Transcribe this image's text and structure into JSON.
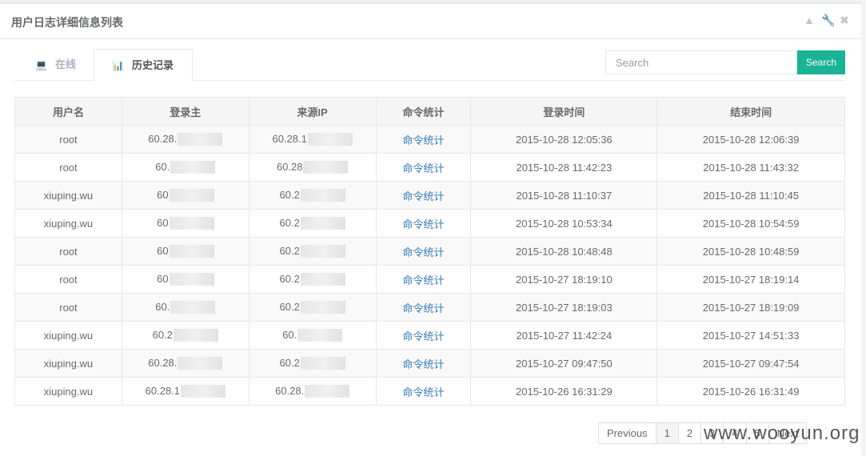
{
  "panel": {
    "title": "用户日志详细信息列表"
  },
  "tools": {
    "collapse": "▲",
    "settings": "🔧",
    "close": "✖"
  },
  "tabs": [
    {
      "label": "在线",
      "icon": "laptop-icon"
    },
    {
      "label": "历史记录",
      "icon": "bar-chart-icon"
    }
  ],
  "search": {
    "placeholder": "Search",
    "button": "Search"
  },
  "table": {
    "headers": [
      "用户名",
      "登录主",
      "来源IP",
      "命令统计",
      "登录时间",
      "结束时间"
    ],
    "rows": [
      {
        "user": "root",
        "host": "60.28.",
        "ip": "60.28.1",
        "cmd": "命令统计",
        "start": "2015-10-28 12:05:36",
        "end": "2015-10-28 12:06:39"
      },
      {
        "user": "root",
        "host": "60.",
        "ip": "60.28",
        "cmd": "命令统计",
        "start": "2015-10-28 11:42:23",
        "end": "2015-10-28 11:43:32"
      },
      {
        "user": "xiuping.wu",
        "host": "60",
        "ip": "60.2",
        "cmd": "命令统计",
        "start": "2015-10-28 11:10:37",
        "end": "2015-10-28 11:10:45"
      },
      {
        "user": "xiuping.wu",
        "host": "60",
        "ip": "60.2",
        "cmd": "命令统计",
        "start": "2015-10-28 10:53:34",
        "end": "2015-10-28 10:54:59"
      },
      {
        "user": "root",
        "host": "60",
        "ip": "60.2",
        "cmd": "命令统计",
        "start": "2015-10-28 10:48:48",
        "end": "2015-10-28 10:48:59"
      },
      {
        "user": "root",
        "host": "60",
        "ip": "60.2",
        "cmd": "命令统计",
        "start": "2015-10-27 18:19:10",
        "end": "2015-10-27 18:19:14"
      },
      {
        "user": "root",
        "host": "60.",
        "ip": "60.2",
        "cmd": "命令统计",
        "start": "2015-10-27 18:19:03",
        "end": "2015-10-27 18:19:09"
      },
      {
        "user": "xiuping.wu",
        "host": "60.2",
        "ip": "60.",
        "cmd": "命令统计",
        "start": "2015-10-27 11:42:24",
        "end": "2015-10-27 14:51:33"
      },
      {
        "user": "xiuping.wu",
        "host": "60.28.",
        "ip": "60.2",
        "cmd": "命令统计",
        "start": "2015-10-27 09:47:50",
        "end": "2015-10-27 09:47:54"
      },
      {
        "user": "xiuping.wu",
        "host": "60.28.1",
        "ip": "60.28.",
        "cmd": "命令统计",
        "start": "2015-10-26 16:31:29",
        "end": "2015-10-26 16:31:49"
      }
    ]
  },
  "pagination": {
    "previous": "Previous",
    "pages": [
      "1",
      "2",
      "3",
      "4",
      "5"
    ],
    "next": "Next"
  },
  "watermark": "www.wooyun.org"
}
